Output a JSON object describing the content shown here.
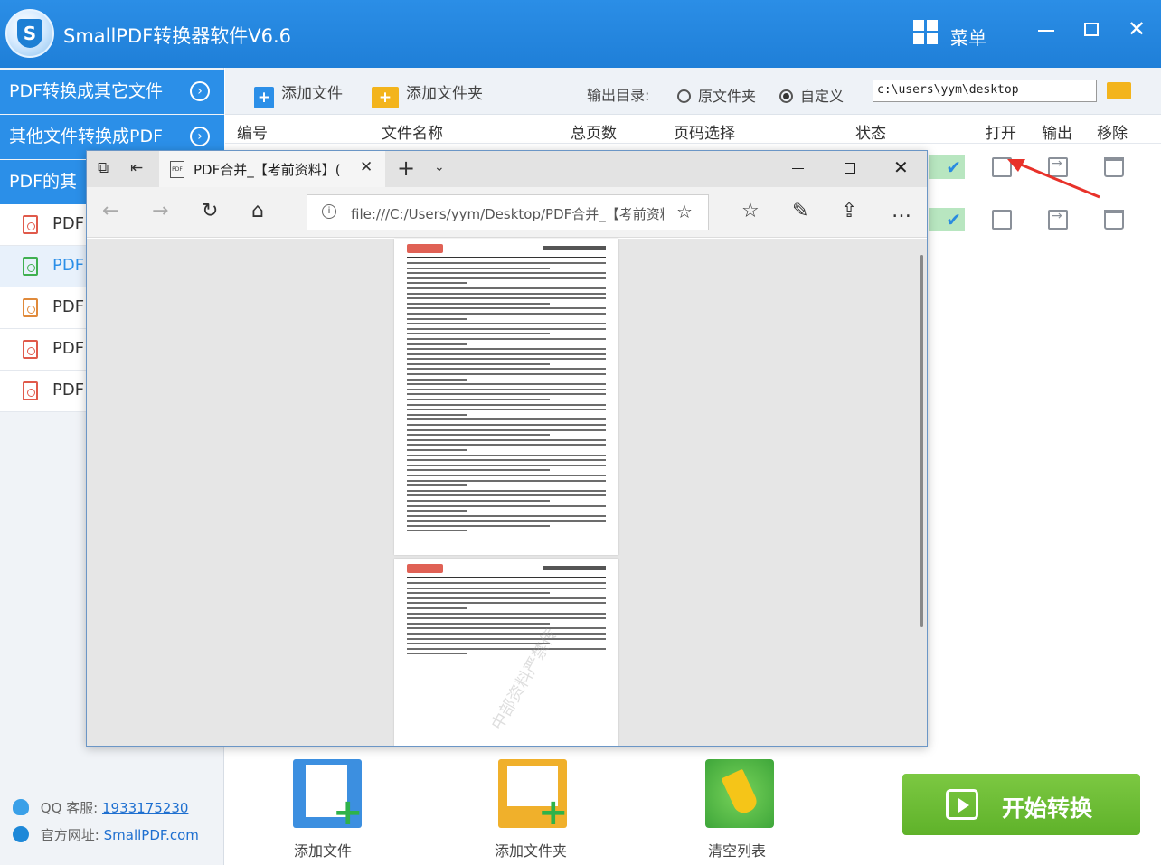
{
  "app": {
    "title": "SmallPDF转换器软件V6.6",
    "menu_label": "菜单",
    "logo_letter": "S"
  },
  "sidebar": {
    "categories": [
      {
        "label": "PDF转换成其它文件"
      },
      {
        "label": "其他文件转换成PDF"
      },
      {
        "label": "PDF的其"
      }
    ],
    "items": [
      {
        "label": "PDF",
        "icon": "pdf-red-icon"
      },
      {
        "label": "PDF",
        "icon": "pdf-green-icon"
      },
      {
        "label": "PDF",
        "icon": "pdf-orange-icon"
      },
      {
        "label": "PDF",
        "icon": "pdf-red-icon"
      },
      {
        "label": "PDF",
        "icon": "pdf-red-icon"
      }
    ],
    "support": {
      "qq_label": "QQ 客服:",
      "qq_value": "1933175230",
      "web_label": "官方网址:",
      "web_value": "SmallPDF.com"
    }
  },
  "toolbar": {
    "add_file": "添加文件",
    "add_folder": "添加文件夹",
    "output_label": "输出目录:",
    "radio_original": "原文件夹",
    "radio_custom": "自定义",
    "output_path": "c:\\users\\yym\\desktop"
  },
  "table": {
    "headers": {
      "index": "编号",
      "name": "文件名称",
      "pages": "总页数",
      "range": "页码选择",
      "status": "状态",
      "open": "打开",
      "output": "输出",
      "remove": "移除"
    }
  },
  "bottom": {
    "add_file": "添加文件",
    "add_folder": "添加文件夹",
    "clear_list": "清空列表",
    "start": "开始转换"
  },
  "browser": {
    "tab_title": "PDF合并_【考前资料】(",
    "favicon_text": "PDF",
    "url": "file:///C:/Users/yym/Desktop/PDF合并_【考前资料】",
    "watermark": "中部资料严禁传"
  },
  "colors": {
    "titlebar": "#2b8ee6",
    "accent": "#2b8fe8",
    "start_button": "#6cbd35",
    "status_done": "#b8e6c0"
  }
}
